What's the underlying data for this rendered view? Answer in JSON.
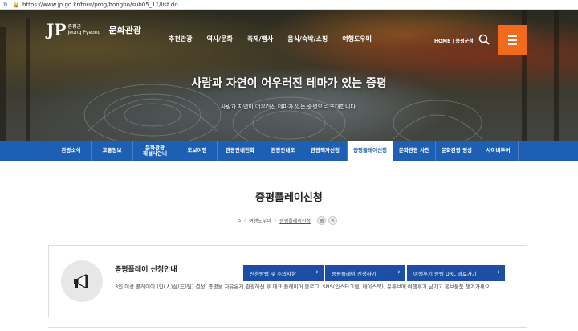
{
  "browser": {
    "url": "https://www.jp.go.kr/tour/prog/hongbo/sub05_11/list.do"
  },
  "header": {
    "logo_mark": "JP",
    "logo_sub": "증평군",
    "logo_sub2": "Jeung Pyeong",
    "site_name": "문화관광",
    "gnb": [
      "추천관광",
      "역사/문화",
      "축제/행사",
      "음식/숙박/쇼핑",
      "여행도우미"
    ],
    "util": "HOME | 증평군청"
  },
  "hero": {
    "title": "사람과 자연이 어우러진 테마가 있는 증평",
    "subtitle": "사람과 자연이 어우러진 테마가 있는 증평으로 초대합니다."
  },
  "lnb": {
    "items": [
      "관광소식",
      "교통정보",
      "문화관광\n해설사안내",
      "도보여행",
      "관광안내전화",
      "관광안내도",
      "관광책자신청",
      "증평플레이신청",
      "문화관광 사진",
      "문화관광 영상",
      "사이버투어"
    ],
    "active_index": 7
  },
  "main": {
    "page_title": "증평플레이신청",
    "breadcrumb": [
      "여행도우미",
      "증평플레이신청"
    ]
  },
  "info": {
    "title": "증평플레이 신청안내",
    "buttons": [
      "신청방법 및 주의사항",
      "증평플레이 신청하기",
      "여행후기 증빙 URL 바로가기"
    ],
    "text": "3인 이상 플레이어 (인(人)삼(三)팀) 결성, 증평을 자유롭게 관광하신 후 대표 플레이어 블로그, SNS(인스타그램, 페이스북), 유튜브에 여행후기 남기고 홍보물품 챙겨가세요."
  },
  "colors": {
    "nav_blue": "#1d5fb3",
    "button_blue": "#1d4ea6",
    "menu_orange": "#f26b1d"
  }
}
